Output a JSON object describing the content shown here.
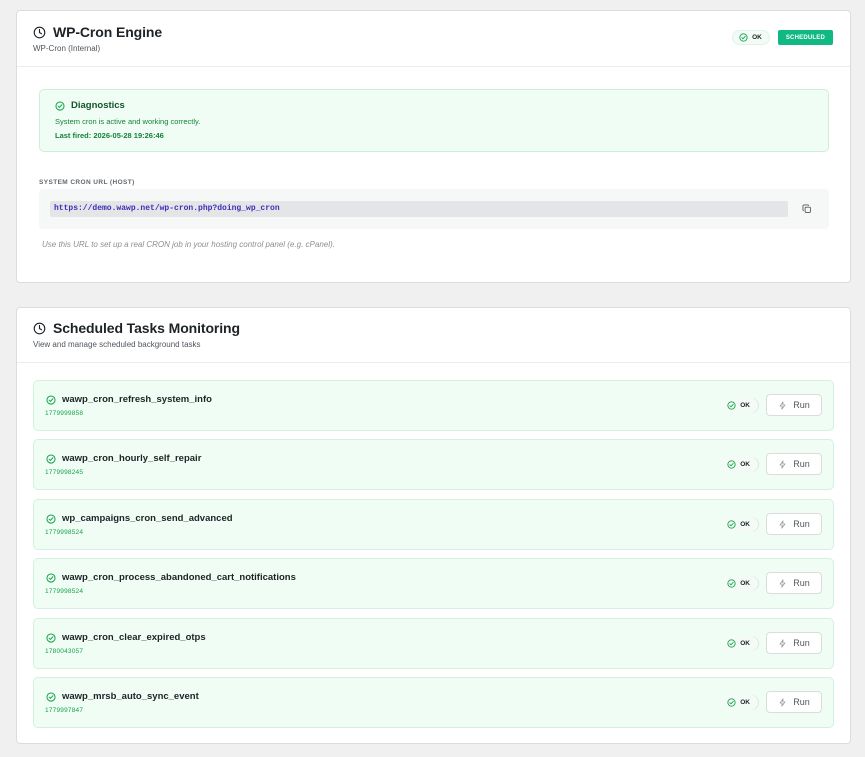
{
  "engine": {
    "title": "WP-Cron Engine",
    "subtitle": "WP-Cron (Internal)",
    "status_ok": "OK",
    "status_badge": "SCHEDULED",
    "diagnostics": {
      "title": "Diagnostics",
      "message": "System cron is active and working correctly.",
      "last_fired": "Last fired: 2026-05-28 19:26:46"
    },
    "url_label": "SYSTEM CRON URL (HOST)",
    "url": "https://demo.wawp.net/wp-cron.php?doing_wp_cron",
    "url_help": "Use this URL to set up a real CRON job in your hosting control panel (e.g. cPanel)."
  },
  "tasks_card": {
    "title": "Scheduled Tasks Monitoring",
    "subtitle": "View and manage scheduled background tasks",
    "ok_label": "OK",
    "run_label": "Run",
    "tasks": [
      {
        "name": "wawp_cron_refresh_system_info",
        "id": "1779999858"
      },
      {
        "name": "wawp_cron_hourly_self_repair",
        "id": "1779998245"
      },
      {
        "name": "wp_campaigns_cron_send_advanced",
        "id": "1779998524"
      },
      {
        "name": "wawp_cron_process_abandoned_cart_notifications",
        "id": "1779998524"
      },
      {
        "name": "wawp_cron_clear_expired_otps",
        "id": "1780043057"
      },
      {
        "name": "wawp_mrsb_auto_sync_event",
        "id": "1779997847"
      }
    ]
  },
  "colors": {
    "accent_green": "#10b981",
    "success_bg": "#f0fdf4",
    "success_text": "#15803d",
    "url_text": "#3b2fb8"
  },
  "icons": {
    "title": "clock-icon",
    "status": "check-circle-icon",
    "copy": "copy-icon",
    "run": "bolt-icon"
  }
}
